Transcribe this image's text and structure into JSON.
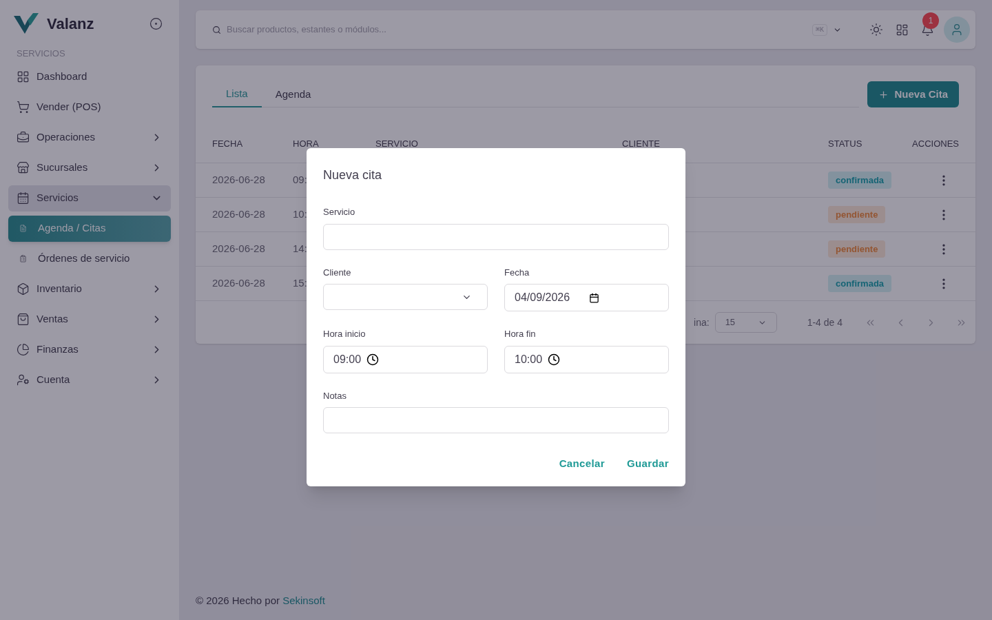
{
  "brand": {
    "name": "Valanz"
  },
  "sidebar": {
    "section": "SERVICIOS",
    "items": [
      {
        "label": "Dashboard",
        "selected": false
      },
      {
        "label": "Vender (POS)",
        "selected": false
      },
      {
        "label": "Operaciones",
        "selected": false,
        "expanded": false
      },
      {
        "label": "Sucursales",
        "selected": false,
        "expanded": false
      },
      {
        "label": "Servicios",
        "selected": false,
        "expanded": true,
        "children": [
          {
            "label": "Agenda / Citas",
            "selected": true
          },
          {
            "label": "Órdenes de servicio",
            "selected": false
          }
        ]
      },
      {
        "label": "Inventario",
        "selected": false,
        "expanded": false
      },
      {
        "label": "Ventas",
        "selected": false,
        "expanded": false
      },
      {
        "label": "Finanzas",
        "selected": false,
        "expanded": false
      },
      {
        "label": "Cuenta",
        "selected": false,
        "expanded": false
      }
    ]
  },
  "topbar": {
    "search": {
      "placeholder": "Buscar productos, estantes o módulos..."
    },
    "shortcut": "⌘K",
    "notifications": "1"
  },
  "tabs": [
    {
      "label": "Lista",
      "selected": true
    },
    {
      "label": "Agenda",
      "selected": false
    }
  ],
  "new_button": "Nueva Cita",
  "table": {
    "columns": [
      "FECHA",
      "HORA",
      "SERVICIO",
      "CLIENTE",
      "STATUS",
      "ACCIONES"
    ],
    "rows": [
      {
        "fecha": "2026-06-28",
        "hora": "09:",
        "status": {
          "label": "confirmada",
          "kind": "confirmed"
        }
      },
      {
        "fecha": "2026-06-28",
        "hora": "10:",
        "status": {
          "label": "pendiente",
          "kind": "pending"
        }
      },
      {
        "fecha": "2026-06-28",
        "hora": "14:",
        "status": {
          "label": "pendiente",
          "kind": "pending"
        }
      },
      {
        "fecha": "2026-06-28",
        "hora": "15:",
        "status": {
          "label": "confirmada",
          "kind": "confirmed"
        }
      }
    ]
  },
  "pagination": {
    "rows_label": "ina:",
    "page_size": "15",
    "range": "1-4 de 4"
  },
  "footer": {
    "text": "© 2026 Hecho por ",
    "link": "Sekinsoft"
  },
  "dialog": {
    "title": "Nueva cita",
    "rows": [
      [
        {
          "label": "Servicio",
          "kind": "text"
        }
      ],
      [
        {
          "label": "Cliente",
          "kind": "select"
        },
        {
          "label": "Fecha",
          "kind": "date",
          "value": "04/09/2026"
        }
      ],
      [
        {
          "label": "Hora inicio",
          "kind": "time",
          "value": "09:00"
        },
        {
          "label": "Hora fin",
          "kind": "time",
          "value": "10:00"
        }
      ],
      [
        {
          "label": "Notas",
          "kind": "text"
        }
      ]
    ],
    "buttons": [
      "Cancelar",
      "Guardar"
    ]
  }
}
